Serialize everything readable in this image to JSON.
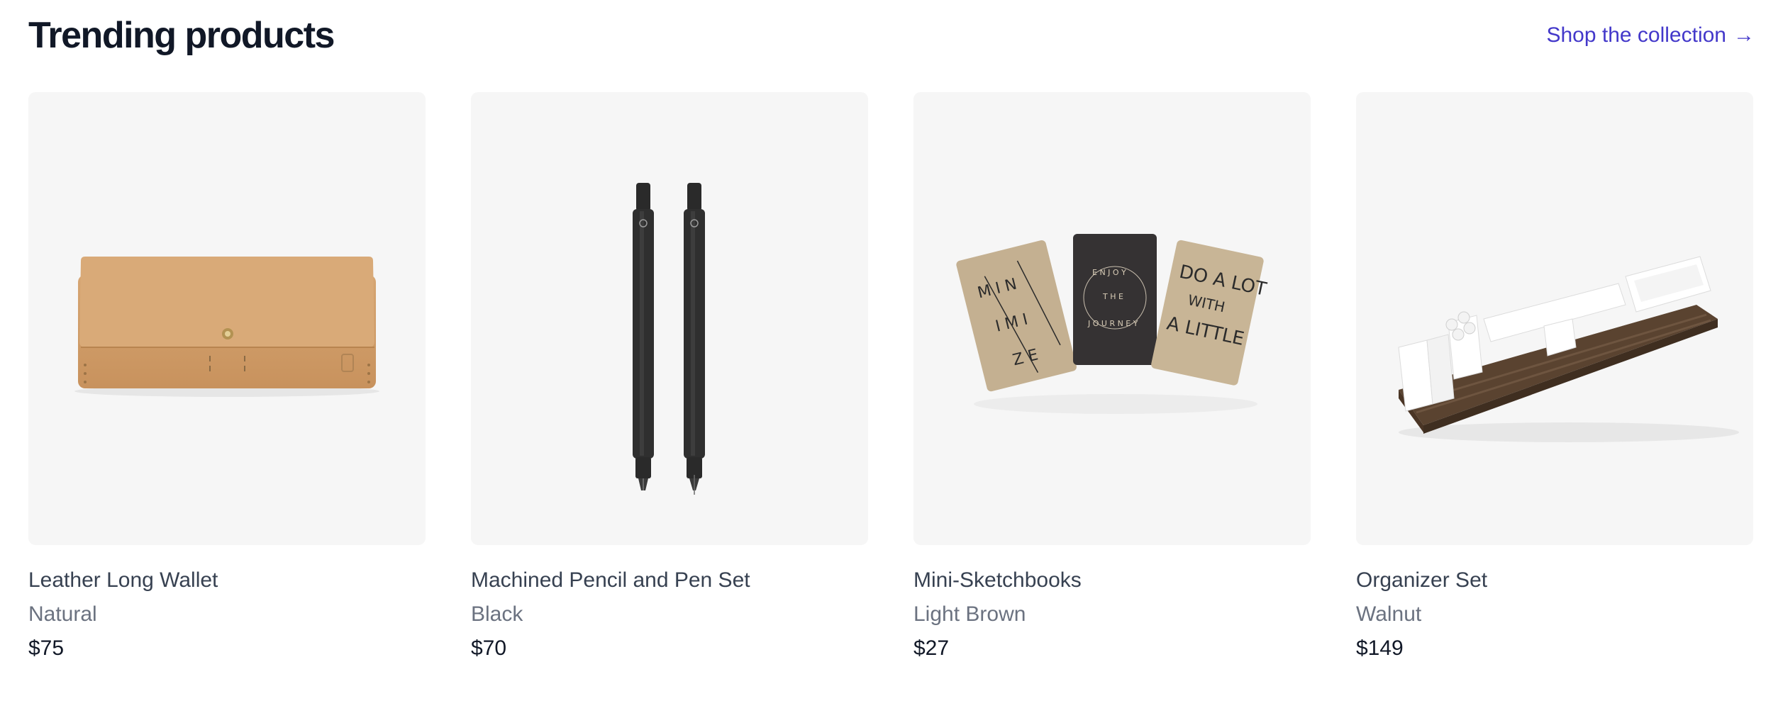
{
  "header": {
    "title": "Trending products",
    "shop_link": "Shop the collection",
    "shop_link_arrow": "→"
  },
  "products": [
    {
      "name": "Leather Long Wallet",
      "color": "Natural",
      "price": "$75",
      "image": "wallet"
    },
    {
      "name": "Machined Pencil and Pen Set",
      "color": "Black",
      "price": "$70",
      "image": "pens"
    },
    {
      "name": "Mini-Sketchbooks",
      "color": "Light Brown",
      "price": "$27",
      "image": "sketchbooks",
      "image_text": {
        "book1": "MINIMIZE",
        "book2": "ENJOY THE JOURNEY",
        "book3": "DO A LOT WITH A LITTLE"
      }
    },
    {
      "name": "Organizer Set",
      "color": "Walnut",
      "price": "$149",
      "image": "organizer"
    }
  ],
  "colors": {
    "accent": "#4338ca",
    "heading": "#111827",
    "muted": "#6b7280",
    "card_bg": "#f6f6f6"
  }
}
